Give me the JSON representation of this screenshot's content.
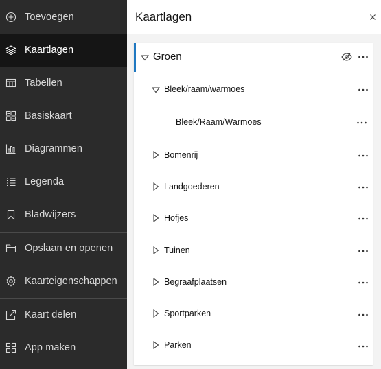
{
  "sidebar": {
    "items": [
      {
        "label": "Toevoegen",
        "icon": "plus-circle-icon"
      },
      {
        "label": "Kaartlagen",
        "icon": "layers-icon",
        "active": true
      },
      {
        "label": "Tabellen",
        "icon": "table-icon"
      },
      {
        "label": "Basiskaart",
        "icon": "basemap-icon"
      },
      {
        "label": "Diagrammen",
        "icon": "chart-icon"
      },
      {
        "label": "Legenda",
        "icon": "legend-icon"
      },
      {
        "label": "Bladwijzers",
        "icon": "bookmark-icon"
      },
      {
        "label": "Opslaan en openen",
        "icon": "folder-icon"
      },
      {
        "label": "Kaarteigenschappen",
        "icon": "gear-icon"
      },
      {
        "label": "Kaart delen",
        "icon": "share-icon"
      },
      {
        "label": "App maken",
        "icon": "apps-icon"
      }
    ]
  },
  "panel": {
    "title": "Kaartlagen",
    "root_layer": {
      "label": "Groen",
      "expanded": true
    },
    "sublayers": [
      {
        "label": "Bleek/raam/warmoes",
        "expanded": true
      },
      {
        "label": "Bleek/Raam/Warmoes",
        "leaf": true
      },
      {
        "label": "Bomenrij",
        "expanded": false
      },
      {
        "label": "Landgoederen",
        "expanded": false
      },
      {
        "label": "Hofjes",
        "expanded": false
      },
      {
        "label": "Tuinen",
        "expanded": false
      },
      {
        "label": "Begraafplaatsen",
        "expanded": false
      },
      {
        "label": "Sportparken",
        "expanded": false
      },
      {
        "label": "Parken",
        "expanded": false
      }
    ]
  },
  "colors": {
    "sidebar_bg": "#2b2b2b",
    "sidebar_active_bg": "#151515",
    "accent": "#1f78c1"
  }
}
